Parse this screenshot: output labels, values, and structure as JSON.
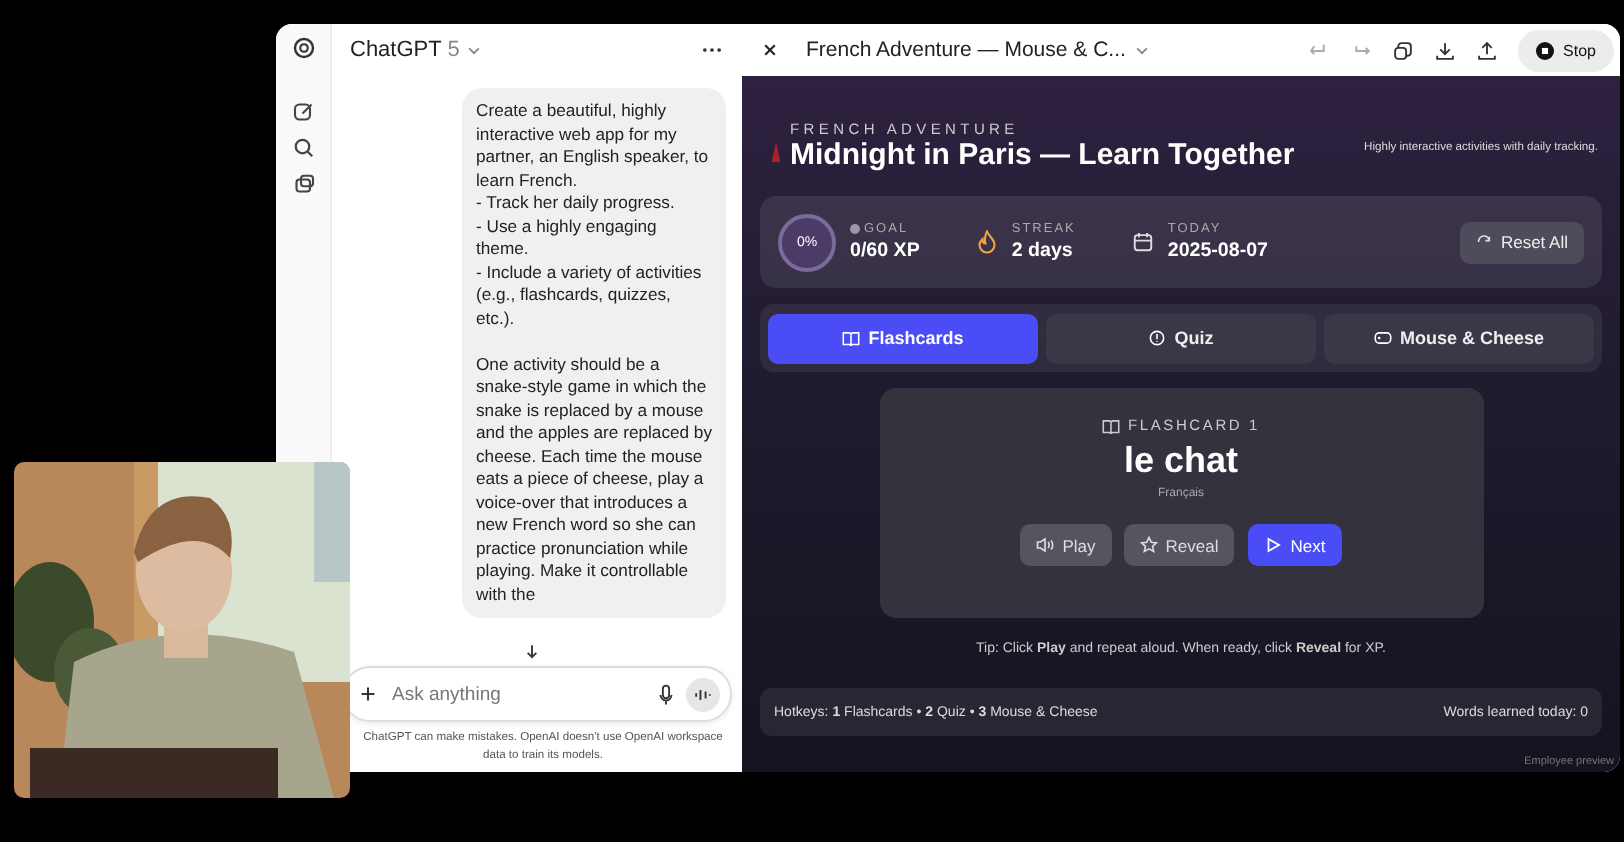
{
  "chat": {
    "title": "ChatGPT",
    "model": "5",
    "message": "Create a beautiful, highly interactive web app for my partner, an English speaker, to learn French.\n- Track her daily progress.\n- Use a highly engaging theme.\n- Include a variety of activities (e.g., flashcards, quizzes, etc.).\n\nOne activity should be a snake-style game in which the snake is replaced by a mouse and the apples are replaced by cheese. Each time the mouse eats a piece of cheese, play a voice-over that introduces a new French word so she can practice pronunciation while playing. Make it controllable with the",
    "input": {
      "placeholder": "Ask anything"
    },
    "disclaimer": "ChatGPT can make mistakes. OpenAI doesn't use OpenAI workspace data to train its models."
  },
  "canvas": {
    "title": "French Adventure — Mouse & C...",
    "stop_label": "Stop"
  },
  "app": {
    "eyebrow": "FRENCH ADVENTURE",
    "heading": "Midnight in Paris — Learn Together",
    "tagline": "Highly interactive activities with daily tracking.",
    "stats": [
      {
        "kind": "ring",
        "value": "0%",
        "label": "GOAL",
        "reading": "0/60 XP"
      },
      {
        "kind": "streak",
        "label": "STREAK",
        "reading": "2 days"
      },
      {
        "kind": "date",
        "label": "TODAY",
        "reading": "2025-08-07"
      }
    ],
    "reset_label": "Reset All",
    "tabs": [
      {
        "label": "Flashcards",
        "kind": "book",
        "selected": true
      },
      {
        "label": "Quiz",
        "kind": "quiz",
        "selected": false
      },
      {
        "label": "Mouse & Cheese",
        "kind": "game",
        "selected": false
      }
    ],
    "card": {
      "caption": "FLASHCARD 1",
      "word": "le chat",
      "language": "Français",
      "buttons": [
        {
          "label": "Play",
          "kind": "play",
          "primary": false
        },
        {
          "label": "Reveal",
          "kind": "reveal",
          "primary": false
        },
        {
          "label": "Next",
          "kind": "next",
          "primary": true
        }
      ]
    },
    "tip": "Tip: Click **Play** and repeat aloud. When ready, click **Reveal** for XP.",
    "hotkeys": "Hotkeys: **1** Flashcards • **2** Quiz • **3** Mouse & Cheese",
    "words_learned": "Words learned today: 0"
  },
  "footer_note": "Employee preview"
}
